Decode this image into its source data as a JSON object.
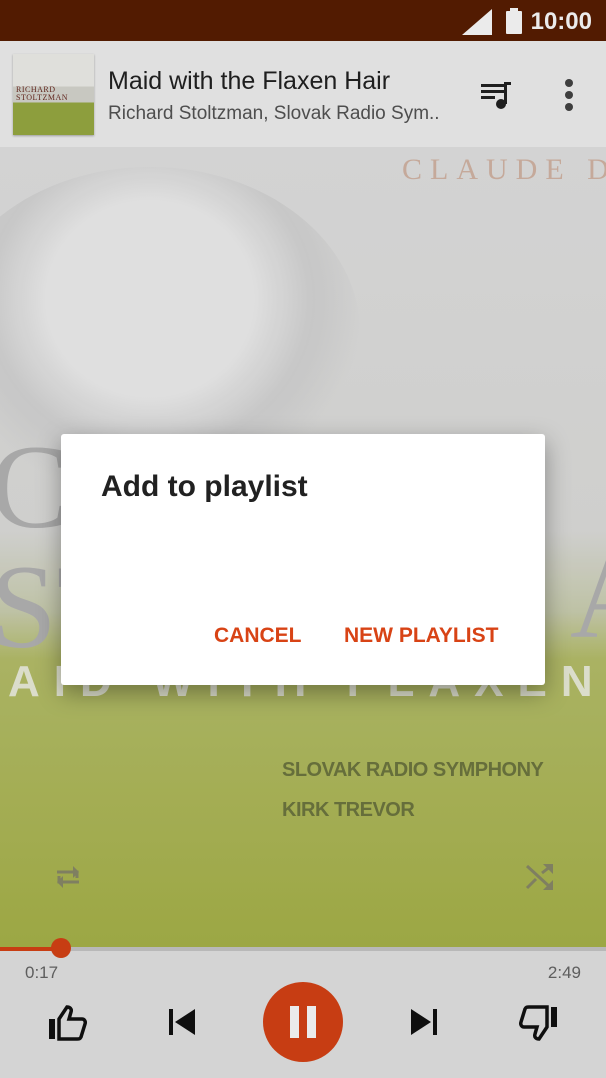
{
  "status_bar": {
    "time": "10:00",
    "icons": [
      "signal-icon",
      "battery-icon"
    ]
  },
  "now_playing": {
    "album_thumb_text": "RICHARD STOLTZMAN",
    "title": "Maid with the Flaxen Hair",
    "artist": "Richard Stoltzman, Slovak Radio Sym..",
    "actions": [
      "queue-icon",
      "more-icon"
    ]
  },
  "album_art": {
    "composer": "CLAUDE D",
    "big_left": "C",
    "big_left2": "ST",
    "big_right": "A",
    "subtitle": "AID WITH FLAXEN",
    "line1": "SLOVAK RADIO SYMPHONY",
    "line2": "KIRK TREVOR"
  },
  "dialog": {
    "title": "Add to playlist",
    "cancel_label": "CANCEL",
    "new_playlist_label": "NEW PLAYLIST"
  },
  "playback": {
    "elapsed": "0:17",
    "total": "2:49",
    "progress_fraction": 0.1
  },
  "colors": {
    "accent": "#d84315",
    "status_bar": "#5a1e02"
  }
}
